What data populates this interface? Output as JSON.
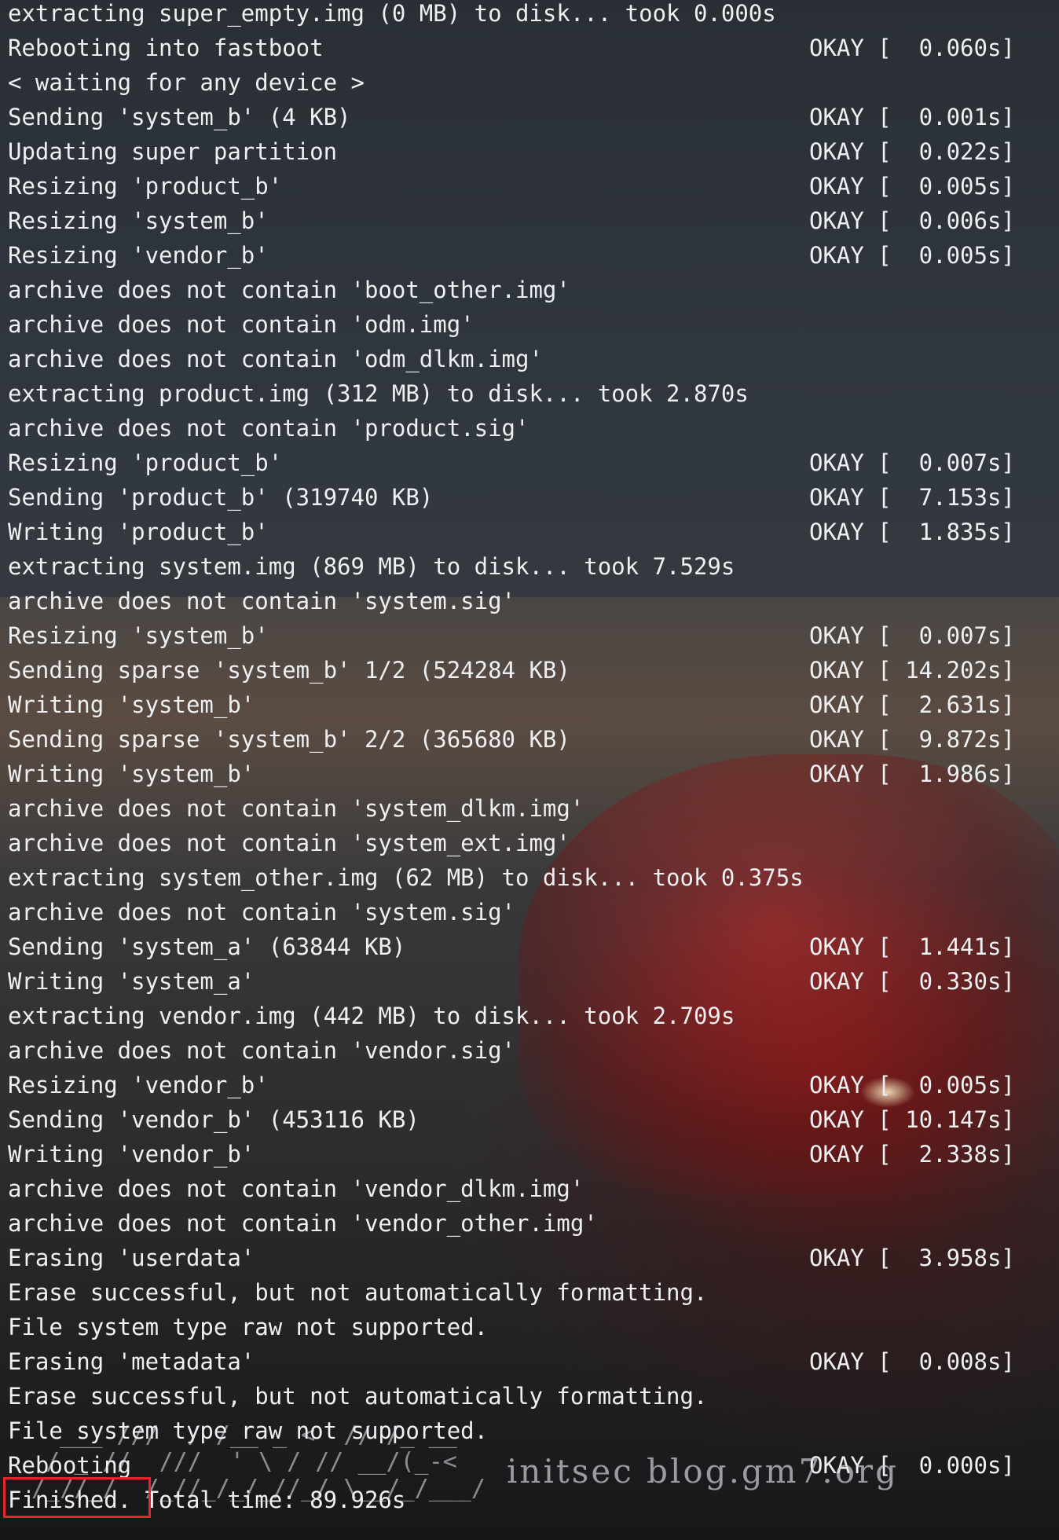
{
  "terminal": {
    "lines": [
      {
        "text": "extracting super_empty.img (0 MB) to disk... took 0.000s",
        "status": ""
      },
      {
        "text": "Rebooting into fastboot",
        "status": "OKAY [  0.060s]"
      },
      {
        "text": "< waiting for any device >",
        "status": ""
      },
      {
        "text": "Sending 'system_b' (4 KB)",
        "status": "OKAY [  0.001s]"
      },
      {
        "text": "Updating super partition",
        "status": "OKAY [  0.022s]"
      },
      {
        "text": "Resizing 'product_b'",
        "status": "OKAY [  0.005s]"
      },
      {
        "text": "Resizing 'system_b'",
        "status": "OKAY [  0.006s]"
      },
      {
        "text": "Resizing 'vendor_b'",
        "status": "OKAY [  0.005s]"
      },
      {
        "text": "archive does not contain 'boot_other.img'",
        "status": ""
      },
      {
        "text": "archive does not contain 'odm.img'",
        "status": ""
      },
      {
        "text": "archive does not contain 'odm_dlkm.img'",
        "status": ""
      },
      {
        "text": "extracting product.img (312 MB) to disk... took 2.870s",
        "status": ""
      },
      {
        "text": "archive does not contain 'product.sig'",
        "status": ""
      },
      {
        "text": "Resizing 'product_b'",
        "status": "OKAY [  0.007s]"
      },
      {
        "text": "Sending 'product_b' (319740 KB)",
        "status": "OKAY [  7.153s]"
      },
      {
        "text": "Writing 'product_b'",
        "status": "OKAY [  1.835s]"
      },
      {
        "text": "extracting system.img (869 MB) to disk... took 7.529s",
        "status": ""
      },
      {
        "text": "archive does not contain 'system.sig'",
        "status": ""
      },
      {
        "text": "Resizing 'system_b'",
        "status": "OKAY [  0.007s]"
      },
      {
        "text": "Sending sparse 'system_b' 1/2 (524284 KB)",
        "status": "OKAY [ 14.202s]"
      },
      {
        "text": "Writing 'system_b'",
        "status": "OKAY [  2.631s]"
      },
      {
        "text": "Sending sparse 'system_b' 2/2 (365680 KB)",
        "status": "OKAY [  9.872s]"
      },
      {
        "text": "Writing 'system_b'",
        "status": "OKAY [  1.986s]"
      },
      {
        "text": "archive does not contain 'system_dlkm.img'",
        "status": ""
      },
      {
        "text": "archive does not contain 'system_ext.img'",
        "status": ""
      },
      {
        "text": "extracting system_other.img (62 MB) to disk... took 0.375s",
        "status": ""
      },
      {
        "text": "archive does not contain 'system.sig'",
        "status": ""
      },
      {
        "text": "Sending 'system_a' (63844 KB)",
        "status": "OKAY [  1.441s]"
      },
      {
        "text": "Writing 'system_a'",
        "status": "OKAY [  0.330s]"
      },
      {
        "text": "extracting vendor.img (442 MB) to disk... took 2.709s",
        "status": ""
      },
      {
        "text": "archive does not contain 'vendor.sig'",
        "status": ""
      },
      {
        "text": "Resizing 'vendor_b'",
        "status": "OKAY [  0.005s]"
      },
      {
        "text": "Sending 'vendor_b' (453116 KB)",
        "status": "OKAY [ 10.147s]"
      },
      {
        "text": "Writing 'vendor_b'",
        "status": "OKAY [  2.338s]"
      },
      {
        "text": "archive does not contain 'vendor_dlkm.img'",
        "status": ""
      },
      {
        "text": "archive does not contain 'vendor_other.img'",
        "status": ""
      },
      {
        "text": "Erasing 'userdata'",
        "status": "OKAY [  3.958s]"
      },
      {
        "text": "Erase successful, but not automatically formatting.",
        "status": ""
      },
      {
        "text": "File system type raw not supported.",
        "status": ""
      },
      {
        "text": "Erasing 'metadata'",
        "status": "OKAY [  0.008s]"
      },
      {
        "text": "Erase successful, but not automatically formatting.",
        "status": ""
      },
      {
        "text": "File system type raw not supported.",
        "status": ""
      },
      {
        "text": "Rebooting",
        "status": "OKAY [  0.000s]"
      },
      {
        "text": "Finished. Total time: 89.926s",
        "status": ""
      }
    ]
  },
  "watermark": {
    "text": "initsec blog.gm7.org",
    "ascii_art": "  ___ ///  / /__ _ <  // /_ __\n / _ //  ///  ' \\ / // __/(_-<\n/_//_/  /_//_/_/_//_/ \\__/_/___/"
  },
  "highlight": {
    "color": "#e8232b",
    "target_text": "Finished"
  }
}
